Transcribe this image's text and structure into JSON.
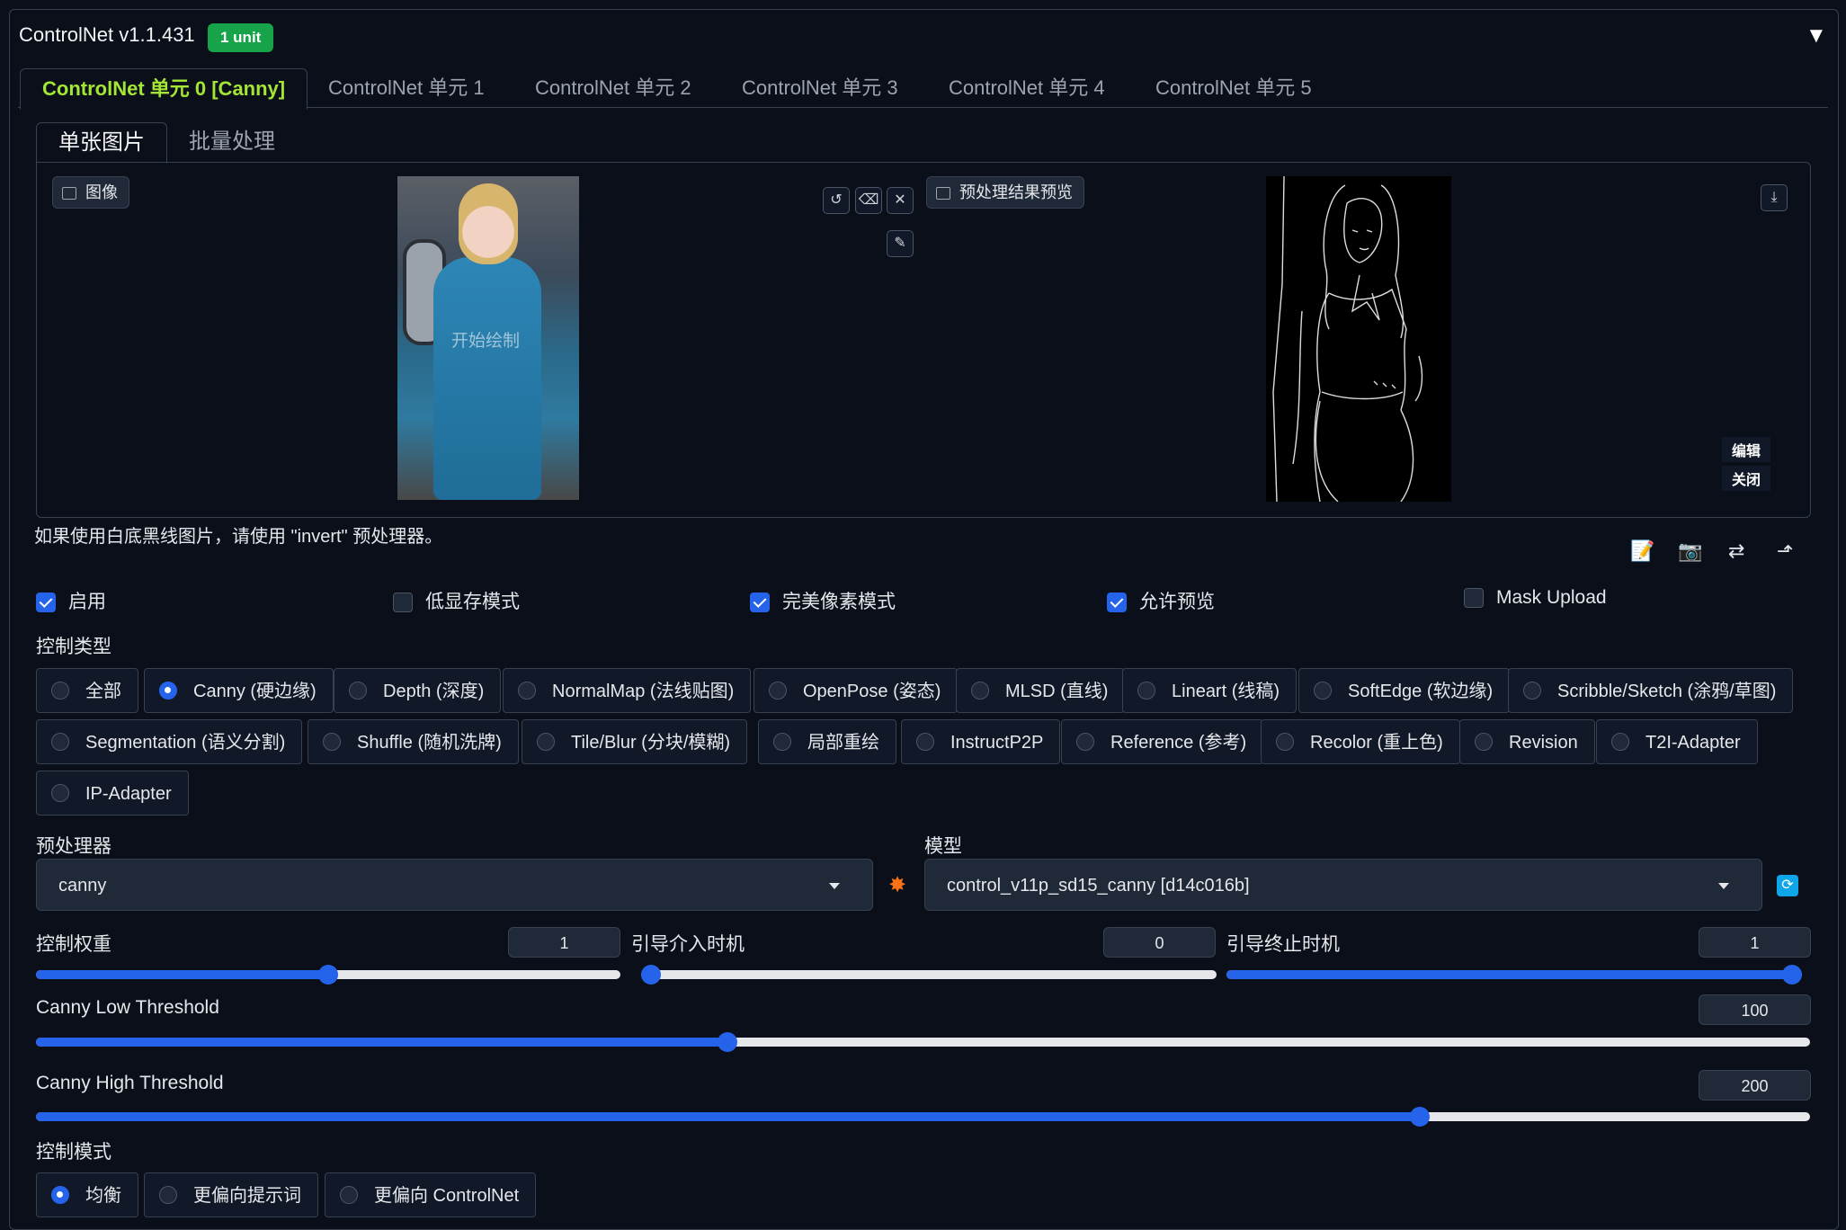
{
  "header": {
    "title": "ControlNet v1.1.431",
    "badge": "1 unit",
    "collapse_icon": "triangle-down-icon"
  },
  "unit_tabs": [
    "ControlNet 单元 0 [Canny]",
    "ControlNet 单元 1",
    "ControlNet 单元 2",
    "ControlNet 单元 3",
    "ControlNet 单元 4",
    "ControlNet 单元 5"
  ],
  "mode_tabs": [
    "单张图片",
    "批量处理"
  ],
  "image_panel": {
    "input_label": "图像",
    "watermark_text": "开始绘制",
    "preview_label": "预处理结果预览",
    "edit_button": "编辑",
    "close_button": "关闭"
  },
  "hint": "如果使用白底黑线图片，请使用 \"invert\" 预处理器。",
  "checkboxes": [
    {
      "label": "启用",
      "checked": true
    },
    {
      "label": "低显存模式",
      "checked": false
    },
    {
      "label": "完美像素模式",
      "checked": true
    },
    {
      "label": "允许预览",
      "checked": true
    },
    {
      "label": "Mask Upload",
      "checked": false
    }
  ],
  "control_type": {
    "label": "控制类型",
    "selected": "Canny (硬边缘)",
    "options": [
      "全部",
      "Canny (硬边缘)",
      "Depth (深度)",
      "NormalMap (法线贴图)",
      "OpenPose (姿态)",
      "MLSD (直线)",
      "Lineart (线稿)",
      "SoftEdge (软边缘)",
      "Scribble/Sketch (涂鸦/草图)",
      "Segmentation (语义分割)",
      "Shuffle (随机洗牌)",
      "Tile/Blur (分块/模糊)",
      "局部重绘",
      "InstructP2P",
      "Reference (参考)",
      "Recolor (重上色)",
      "Revision",
      "T2I-Adapter",
      "IP-Adapter"
    ]
  },
  "preprocessor": {
    "label": "预处理器",
    "value": "canny"
  },
  "model": {
    "label": "模型",
    "value": "control_v11p_sd15_canny [d14c016b]"
  },
  "sliders": {
    "weight": {
      "label": "控制权重",
      "value": "1",
      "fraction": 0.5
    },
    "start": {
      "label": "引导介入时机",
      "value": "0",
      "fraction": 0.0
    },
    "end": {
      "label": "引导终止时机",
      "value": "1",
      "fraction": 1.0
    },
    "low": {
      "label": "Canny Low Threshold",
      "value": "100",
      "fraction": 0.39
    },
    "high": {
      "label": "Canny High Threshold",
      "value": "200",
      "fraction": 0.78
    }
  },
  "control_mode": {
    "label": "控制模式",
    "selected": "均衡",
    "options": [
      "均衡",
      "更偏向提示词",
      "更偏向 ControlNet"
    ]
  }
}
